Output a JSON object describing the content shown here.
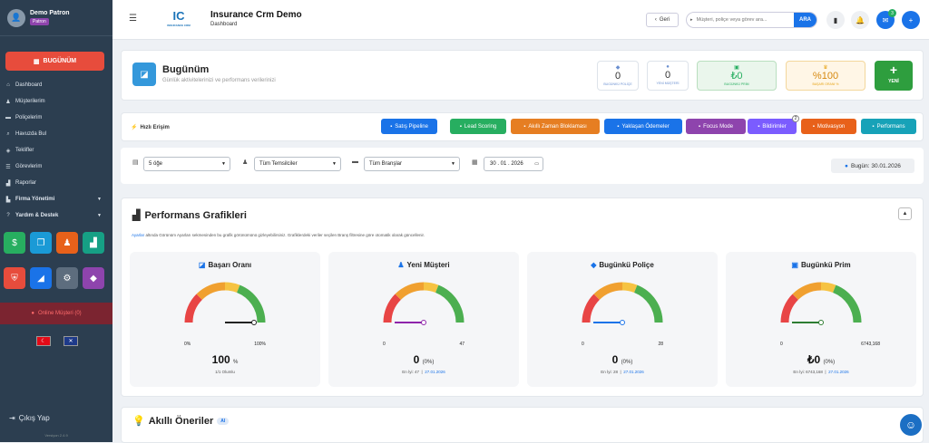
{
  "user": {
    "name": "Demo Patron",
    "role": "Patron"
  },
  "sidebar": {
    "today_label": "BUGÜNÜM",
    "items": [
      {
        "label": "Dashboard",
        "icon": "home-icon"
      },
      {
        "label": "Müşterilerim",
        "icon": "users-icon"
      },
      {
        "label": "Poliçelerim",
        "icon": "folder-icon"
      },
      {
        "label": "Havuzda Bul",
        "icon": "search-icon"
      },
      {
        "label": "Teklifler",
        "icon": "tag-icon"
      },
      {
        "label": "Görevlerim",
        "icon": "list-icon"
      },
      {
        "label": "Raporlar",
        "icon": "chart-icon"
      },
      {
        "label": "Firma Yönetimi",
        "icon": "building-icon"
      },
      {
        "label": "Yardım & Destek",
        "icon": "help-icon"
      }
    ],
    "online_label": "Online Müşteri (0)",
    "logout_label": "Çıkış Yap",
    "version": "Versiyon 2.4.9"
  },
  "header": {
    "app_title": "Insurance Crm Demo",
    "page": "Dashboard",
    "logo_text": "INSURANCE CRM",
    "back_label": "Geri",
    "search_placeholder": "Müşteri, poliçe veya görev ara...",
    "search_button": "ARA",
    "notif_count": "3"
  },
  "hero": {
    "title": "Bugünüm",
    "subtitle": "Günlük aktivitelerinizi ve performans verilerinizi",
    "stats": [
      {
        "value": "0",
        "label": "BUGÜNKÜ POLİÇE",
        "icon": "doc-icon"
      },
      {
        "value": "0",
        "label": "YENİ MÜŞTERİ",
        "icon": "user-icon"
      },
      {
        "value": "₺0",
        "label": "BUGÜNKÜ PRİM",
        "icon": "money-icon"
      },
      {
        "value": "%100",
        "label": "BAŞARI ORANI %",
        "icon": "trophy-icon"
      }
    ],
    "new_label": "YENİ"
  },
  "quick": {
    "title": "Hızlı Erişim",
    "buttons": [
      {
        "label": "Satış Pipeline",
        "color": "#1a73e8"
      },
      {
        "label": "Lead Scoring",
        "color": "#27ae60"
      },
      {
        "label": "Akıllı Zaman Bloklaması",
        "color": "#e67e22"
      },
      {
        "label": "Yaklaşan Ödemeler",
        "color": "#1a73e8"
      },
      {
        "label": "Focus Mode",
        "color": "#8e44ad"
      },
      {
        "label": "Bildirimler",
        "color": "#7b5cff",
        "badge": "2"
      },
      {
        "label": "Motivasyon",
        "color": "#e8611a"
      },
      {
        "label": "Performans",
        "color": "#17a2b8"
      }
    ]
  },
  "filters": {
    "count": "5 öğe",
    "rep": "Tüm Temsilciler",
    "branch": "Tüm Branşlar",
    "date": "30 . 01 . 2026",
    "today": "Bugün: 30.01.2026"
  },
  "perf": {
    "title": "Performans Grafikleri",
    "note_link": "Ayarlar",
    "note": " altında Görünüm Ayarları sekmesinden bu grafik görünümünü gizleyebilirsiniz. Grafiklerdeki veriler seçilen Branş filtresine göre otomatik olarak güncellenir.",
    "gauges": [
      {
        "title": "Başarı Oranı",
        "min": "0%",
        "max": "100%",
        "value": "100",
        "unit": "%",
        "foot1": "1/1 Olumlu",
        "foot2": "",
        "level": 1.0,
        "needle": "#222",
        "small_label": "0%"
      },
      {
        "title": "Yeni Müşteri",
        "min": "0",
        "max": "47",
        "value": "0",
        "unit": "(0%)",
        "foot1": "En İyi: 47",
        "foot2": "27.01.2026",
        "level": 0.0,
        "needle": "#8e24aa",
        "small_label": "0"
      },
      {
        "title": "Bugünkü Poliçe",
        "min": "0",
        "max": "28",
        "value": "0",
        "unit": "(0%)",
        "foot1": "En İyi: 28",
        "foot2": "27.01.2026",
        "level": 0.0,
        "needle": "#1a73e8",
        "small_label": "0"
      },
      {
        "title": "Bugünkü Prim",
        "min": "0",
        "max": "6743,168",
        "value": "₺0",
        "unit": "(0%)",
        "foot1": "En İyi: 6743,168",
        "foot2": "27.01.2026",
        "level": 0.0,
        "needle": "#2e7d32",
        "small_label": "0"
      }
    ]
  },
  "ai": {
    "title": "Akıllı Öneriler",
    "badge": "AI"
  }
}
